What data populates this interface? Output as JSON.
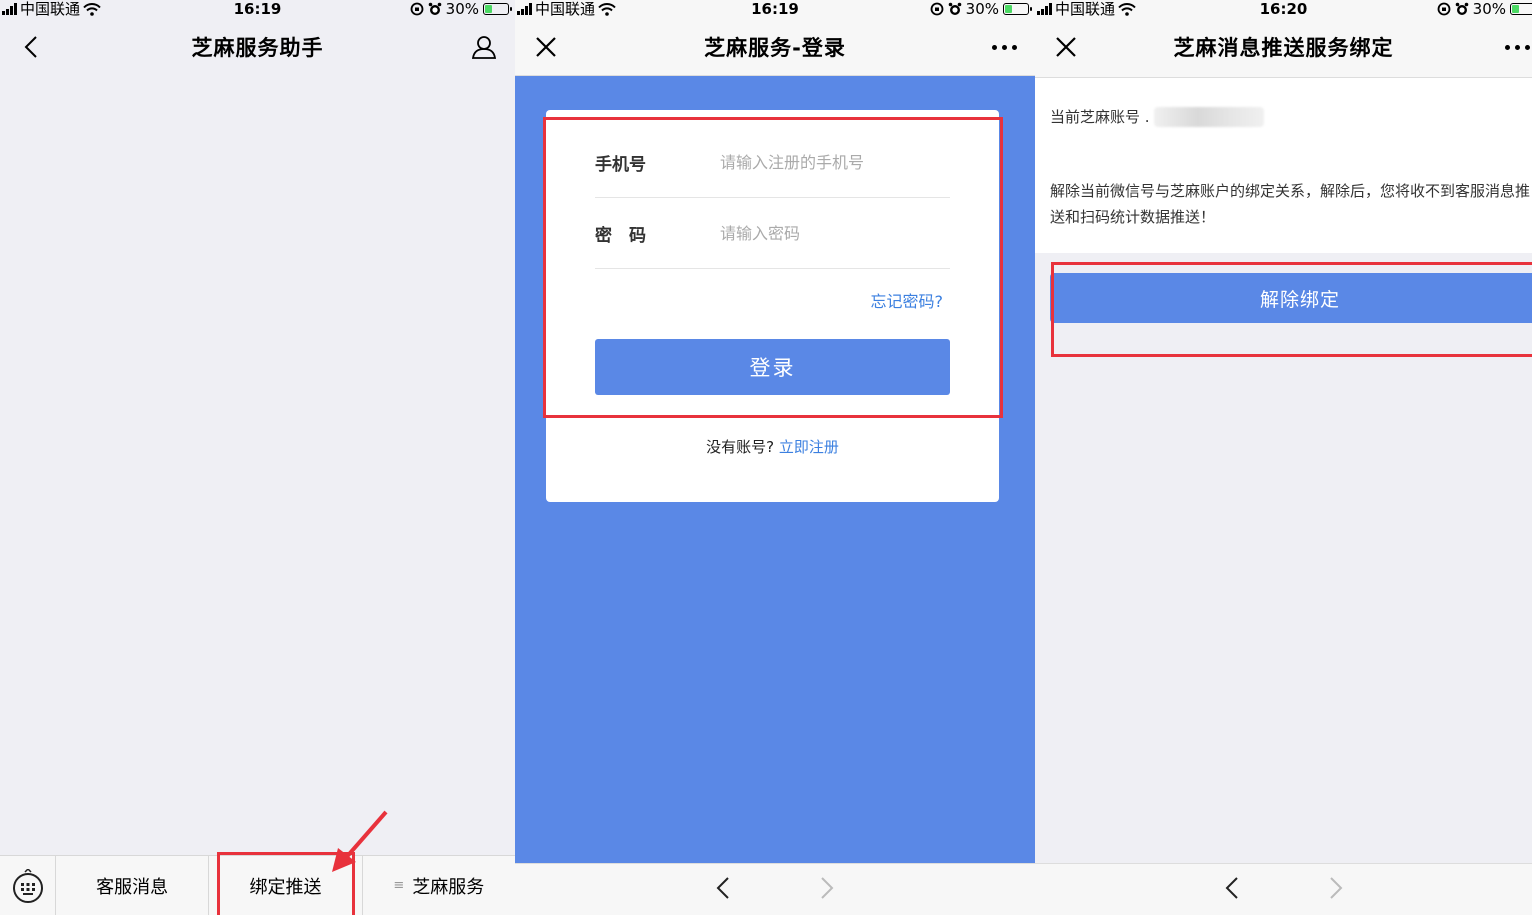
{
  "status_bars": [
    {
      "carrier": "中国联通",
      "time": "16:19",
      "battery": "30%"
    },
    {
      "carrier": "中国联通",
      "time": "16:19",
      "battery": "30%"
    },
    {
      "carrier": "中国联通",
      "time": "16:20",
      "battery": "30%"
    }
  ],
  "panel1": {
    "title": "芝麻服务助手",
    "menu": [
      "客服消息",
      "绑定推送",
      "芝麻服务"
    ]
  },
  "panel2": {
    "title": "芝麻服务-登录",
    "phone_label": "手机号",
    "phone_placeholder": "请输入注册的手机号",
    "password_label": "密　码",
    "password_placeholder": "请输入密码",
    "forgot": "忘记密码?",
    "login_button": "登录",
    "no_account": "没有账号?",
    "register": "立即注册"
  },
  "panel3": {
    "title": "芝麻消息推送服务绑定",
    "account_label": "当前芝麻账号 .",
    "description": "解除当前微信号与芝麻账户的绑定关系，解除后，您将收不到客服消息推送和扫码统计数据推送！",
    "unbind_button": "解除绑定"
  },
  "colors": {
    "accent": "#5a88e6",
    "link": "#3c80e0",
    "highlight": "#e8323c",
    "battery": "#4cd964"
  }
}
